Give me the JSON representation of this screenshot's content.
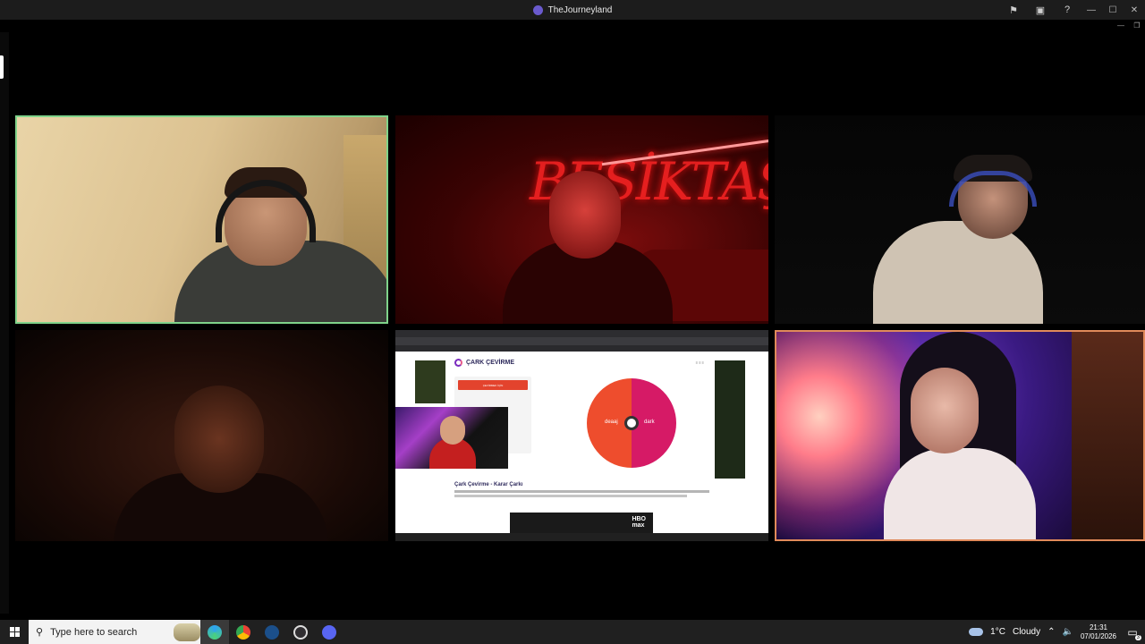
{
  "window": {
    "title": "TheJourneyland",
    "title_icon": "app-logo-icon",
    "toolbar_icons": [
      "flag-icon",
      "screen-share-icon",
      "help-icon"
    ],
    "controls": [
      "minimize",
      "maximize",
      "close"
    ]
  },
  "tiles": [
    {
      "id": "participant-1",
      "scene": "beige-wall",
      "highlight_color": "#7fd38a",
      "active_speaker": true
    },
    {
      "id": "participant-2",
      "scene": "red-neon-room",
      "neon_text": "BEŞİKTAŞ"
    },
    {
      "id": "participant-3",
      "scene": "dark-room"
    },
    {
      "id": "participant-4",
      "scene": "dim-orange-room"
    },
    {
      "id": "shared-screen",
      "scene": "browser-share"
    },
    {
      "id": "participant-6",
      "scene": "purple-fairy-lights",
      "highlight_color": "#e08a5a"
    }
  ],
  "shared_screen": {
    "site_name": "ÇARK ÇEVİRME",
    "panel_button": "ÇEVİRMEK İÇİN",
    "wheel_left_label": "deaaj",
    "wheel_right_label": "dark",
    "wheel_colors": [
      "#d61a66",
      "#ee4d2d"
    ],
    "heading": "Çark Çevirme - Karar Çarkı",
    "ad_logo_line1": "HBO",
    "ad_logo_line2": "max"
  },
  "taskbar": {
    "search_placeholder": "Type here to search",
    "apps": [
      "edge-icon",
      "chrome-icon",
      "steam-icon",
      "obs-icon",
      "discord-icon"
    ],
    "weather_temp": "1°C",
    "weather_desc": "Cloudy",
    "time": "21:31",
    "date": "07/01/2026",
    "notification_count": "3"
  }
}
